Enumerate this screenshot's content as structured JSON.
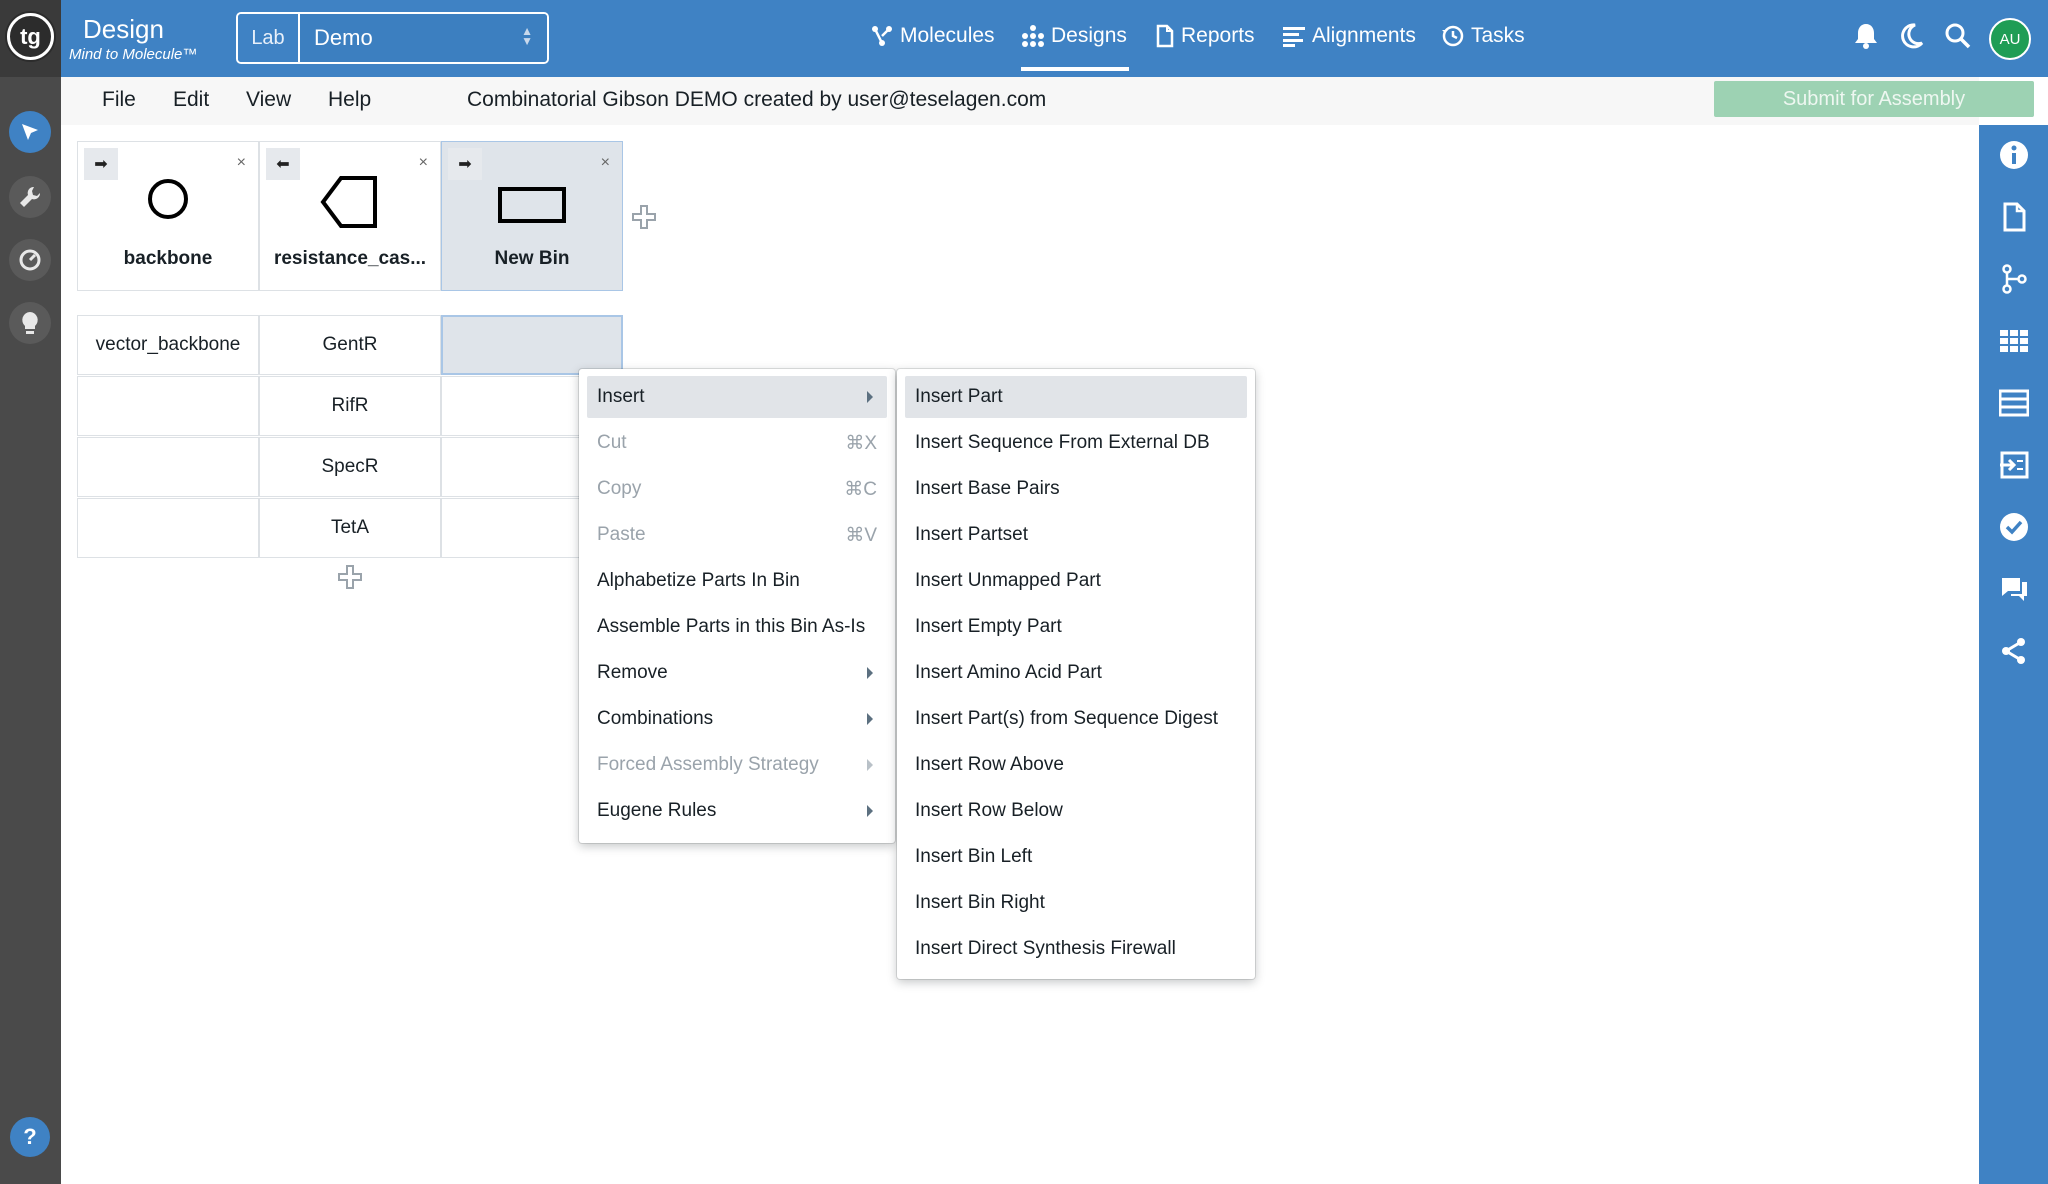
{
  "colors": {
    "topbar": "#3f82c4",
    "sidebar": "#4a4a4a",
    "submit": "#9dd2b3",
    "selected_bin": "#dfe4ea"
  },
  "header": {
    "logo": "tg",
    "title": "Design",
    "subtitle": "Mind to Molecule™",
    "lab_label": "Lab",
    "lab_value": "Demo",
    "nav": [
      {
        "label": "Molecules",
        "icon": "molecule-icon"
      },
      {
        "label": "Designs",
        "icon": "designs-icon",
        "active": true
      },
      {
        "label": "Reports",
        "icon": "document-icon"
      },
      {
        "label": "Alignments",
        "icon": "alignments-icon"
      },
      {
        "label": "Tasks",
        "icon": "history-icon"
      }
    ],
    "avatar": "AU"
  },
  "menubar": {
    "items": [
      "File",
      "Edit",
      "View",
      "Help"
    ],
    "design_title": "Combinatorial Gibson DEMO created by user@teselagen.com",
    "submit_label": "Submit for Assembly"
  },
  "bins": [
    {
      "name": "backbone",
      "icon": "origin-circle-icon",
      "direction": "forward"
    },
    {
      "name": "resistance_cas...",
      "icon": "reverse-cds-icon",
      "direction": "reverse"
    },
    {
      "name": "New Bin",
      "icon": "cds-box-icon",
      "direction": "forward",
      "selected": true
    }
  ],
  "grid": [
    [
      "vector_backbone",
      "GentR",
      ""
    ],
    [
      "",
      "RifR",
      ""
    ],
    [
      "",
      "SpecR",
      ""
    ],
    [
      "",
      "TetA",
      ""
    ]
  ],
  "context_menu": {
    "items": [
      {
        "label": "Insert",
        "submenu": true,
        "active": true
      },
      {
        "label": "Cut",
        "shortcut": "⌘X",
        "disabled": true
      },
      {
        "label": "Copy",
        "shortcut": "⌘C",
        "disabled": true
      },
      {
        "label": "Paste",
        "shortcut": "⌘V",
        "disabled": true
      },
      {
        "label": "Alphabetize Parts In Bin"
      },
      {
        "label": "Assemble Parts in this Bin As-Is"
      },
      {
        "label": "Remove",
        "submenu": true
      },
      {
        "label": "Combinations",
        "submenu": true
      },
      {
        "label": "Forced Assembly Strategy",
        "submenu": true,
        "disabled": true
      },
      {
        "label": "Eugene Rules",
        "submenu": true
      }
    ]
  },
  "insert_submenu": {
    "items": [
      "Insert Part",
      "Insert Sequence From External DB",
      "Insert Base Pairs",
      "Insert Partset",
      "Insert Unmapped Part",
      "Insert Empty Part",
      "Insert Amino Acid Part",
      "Insert Part(s) from Sequence Digest",
      "Insert Row Above",
      "Insert Row Below",
      "Insert Bin Left",
      "Insert Bin Right",
      "Insert Direct Synthesis Firewall"
    ]
  }
}
